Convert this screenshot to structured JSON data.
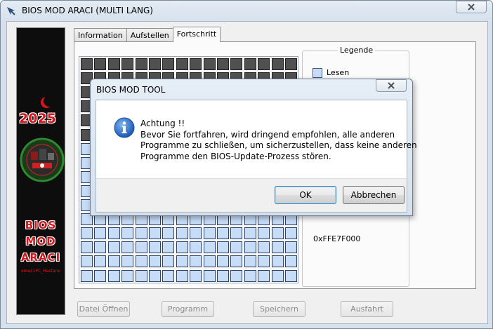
{
  "window": {
    "title": "BIOS MOD ARACI (MULTI LANG)",
    "icon": "app-arrow-icon",
    "close_icon": "close-x-icon"
  },
  "banner": {
    "year": "2025",
    "line1": "BIOS",
    "line2": "MOD",
    "line3": "ARACI",
    "small": "email1PC_Hastane"
  },
  "tabs": [
    {
      "label": "Information"
    },
    {
      "label": "Aufstellen"
    },
    {
      "label": "Fortschritt"
    }
  ],
  "active_tab": "Fortschritt",
  "legend": {
    "title": "Legende",
    "items": [
      {
        "label": "Lesen",
        "color": "#c6dcf7"
      }
    ],
    "address": "0xFFE7F000"
  },
  "grid_colors": {
    "done": "#505050",
    "pending": "#c6dcf7"
  },
  "bottom_buttons": [
    {
      "label": "Datei Öffnen"
    },
    {
      "label": "Programm"
    },
    {
      "label": "Speichern"
    },
    {
      "label": "Ausfahrt"
    }
  ],
  "dialog": {
    "title": "BIOS MOD TOOL",
    "icon": "info-icon",
    "lines": [
      "Achtung !!",
      "Bevor Sie fortfahren, wird dringend empfohlen, alle anderen",
      "Programme zu schließen, um sicherzustellen, dass keine anderen",
      "Programme den BIOS-Update-Prozess stören."
    ],
    "ok_label": "OK",
    "cancel_label": "Abbrechen"
  }
}
